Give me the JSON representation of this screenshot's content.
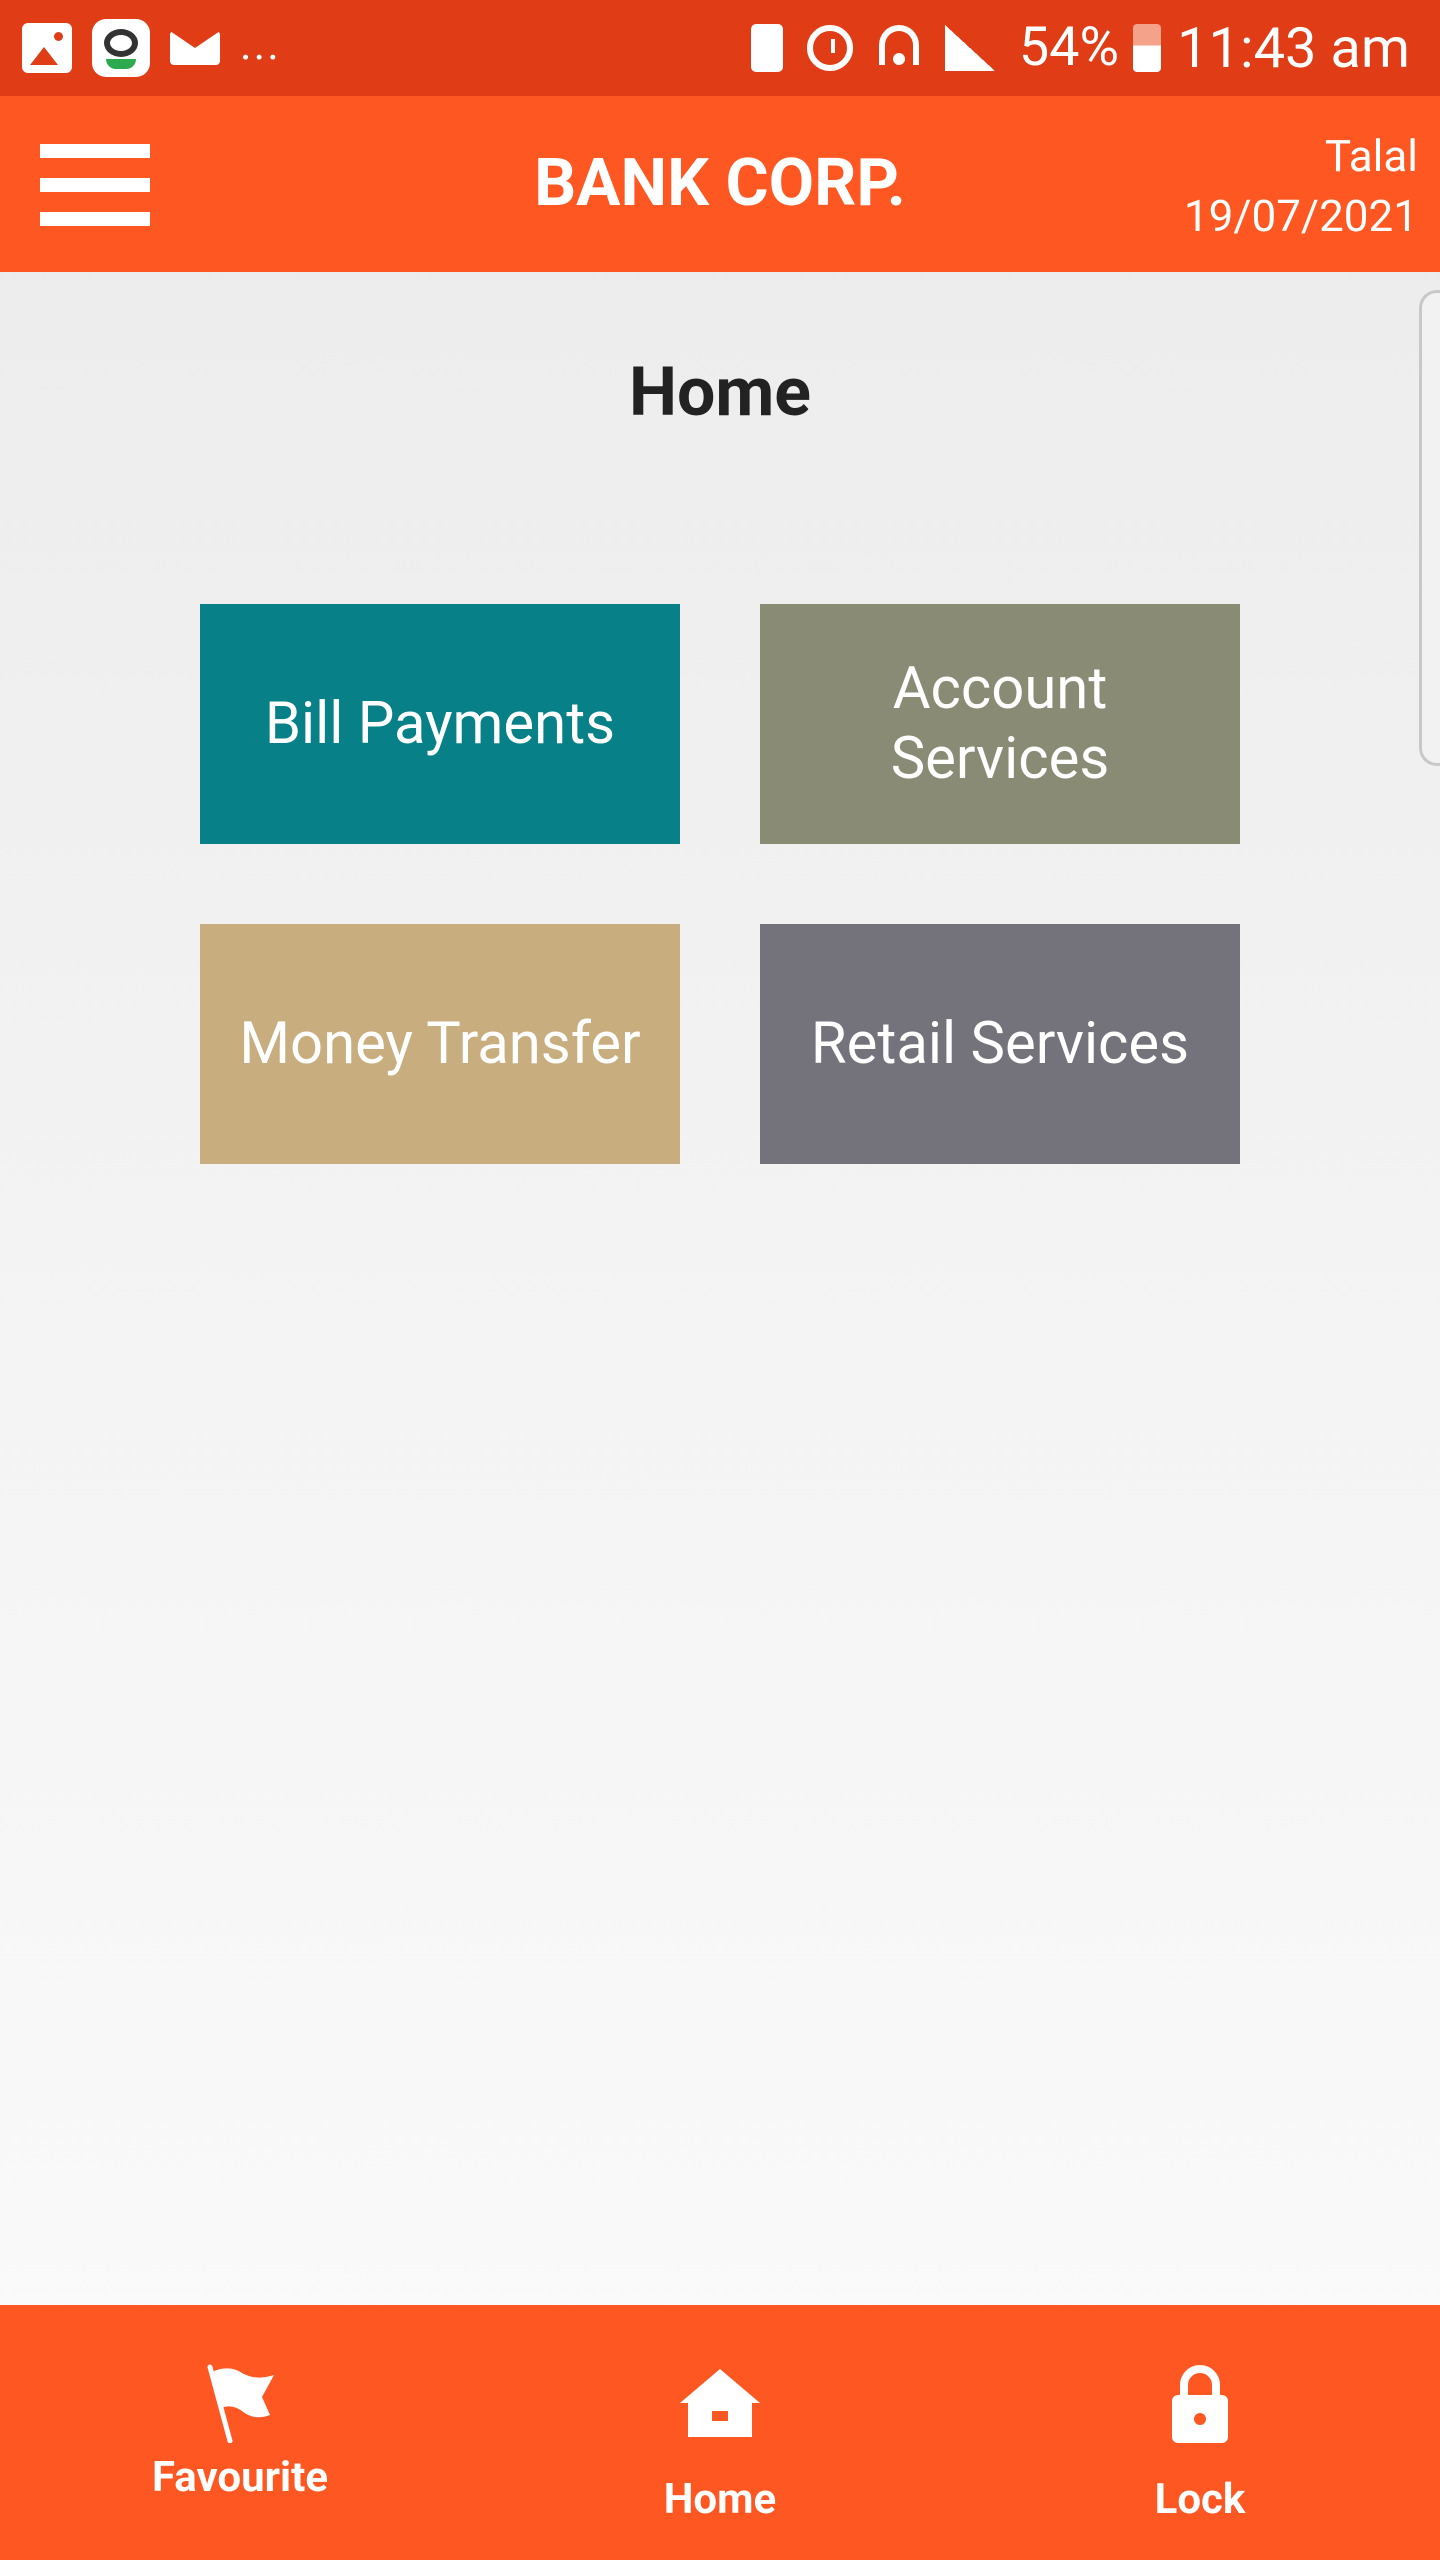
{
  "status_bar": {
    "battery_percent": "54%",
    "time": "11:43 am",
    "overflow": "...",
    "icons": [
      "gallery-icon",
      "app-icon",
      "mail-icon",
      "battery-saver-icon",
      "alarm-icon",
      "wifi-icon",
      "signal-icon",
      "battery-icon"
    ]
  },
  "header": {
    "title": "BANK CORP.",
    "user_name": "Talal",
    "date": "19/07/2021"
  },
  "main": {
    "page_title": "Home",
    "tiles": [
      {
        "label": "Bill Payments",
        "color": "#078088"
      },
      {
        "label": "Account Services",
        "color": "#8a8b74"
      },
      {
        "label": "Money Transfer",
        "color": "#c8ad7f"
      },
      {
        "label": "Retail Services",
        "color": "#74737b"
      }
    ]
  },
  "bottom_nav": {
    "items": [
      {
        "label": "Favourite",
        "icon": "flag-icon"
      },
      {
        "label": "Home",
        "icon": "house-icon"
      },
      {
        "label": "Lock",
        "icon": "lock-icon"
      }
    ]
  },
  "colors": {
    "status_bar": "#e03c15",
    "primary": "#ff5722",
    "background": "#f2f2f2"
  }
}
